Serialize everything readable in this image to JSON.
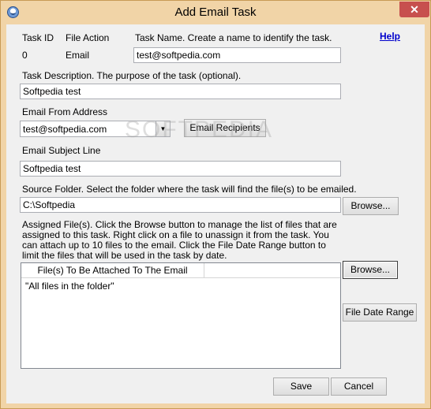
{
  "window": {
    "title": "Add Email Task",
    "close_glyph": "✕"
  },
  "header": {
    "task_id_label": "Task ID",
    "task_id_value": "0",
    "file_action_label": "File Action",
    "file_action_value": "Email",
    "task_name_label": "Task Name. Create a name to identify the task.",
    "task_name_value": "test@softpedia.com",
    "help_link": "Help"
  },
  "description": {
    "label": "Task Description. The purpose of the task (optional).",
    "value": "Softpedia test"
  },
  "email_from": {
    "label": "Email From Address",
    "selected": "test@softpedia.com",
    "recipients_button": "Email Recipients"
  },
  "subject": {
    "label": "Email Subject Line",
    "value": "Softpedia test"
  },
  "source_folder": {
    "label": "Source Folder. Select the folder where the task will find the file(s) to be emailed.",
    "value": "C:\\Softpedia",
    "browse_button": "Browse..."
  },
  "assigned_files": {
    "description": "Assigned File(s). Click the Browse button to manage the list of files that are assigned to this task. Right click on a file to unassign it from the task. You can attach up to 10 files to the email. Click the File Date Range button to limit the files that will be used in the task by date.",
    "column_header": "File(s) To Be Attached To The Email",
    "rows": [
      "\"All files in the folder\""
    ],
    "browse_button": "Browse...",
    "date_range_button": "File Date Range"
  },
  "footer": {
    "save_button": "Save",
    "cancel_button": "Cancel"
  },
  "watermark": "SOFTPEDIA"
}
